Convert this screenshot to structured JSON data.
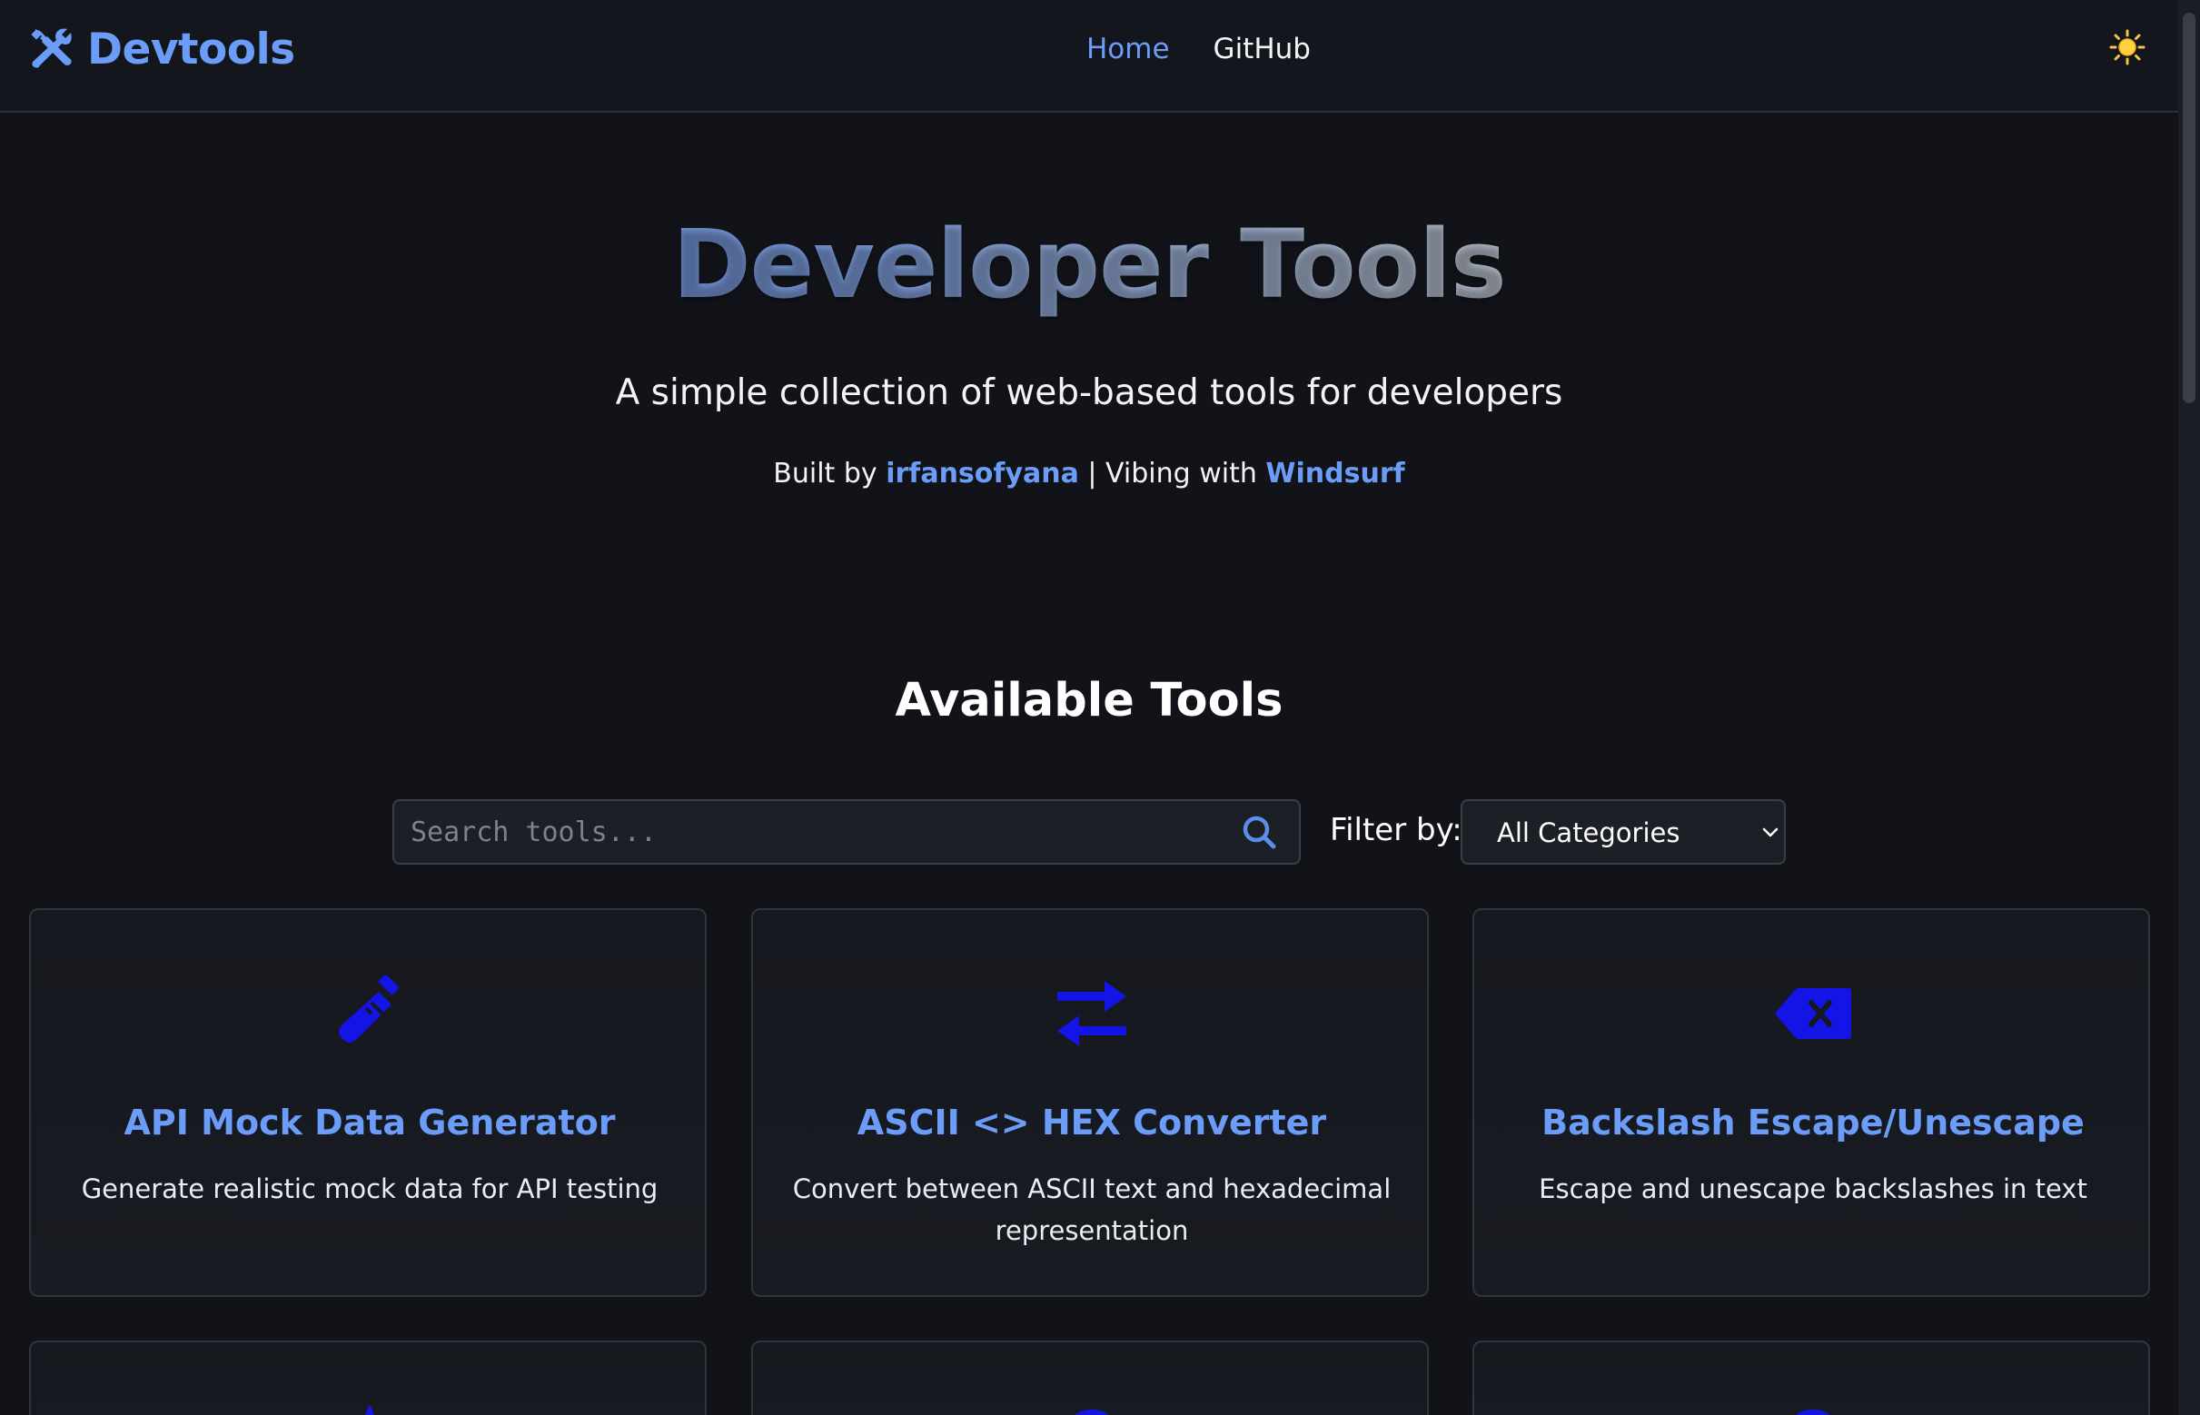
{
  "header": {
    "brand": "Devtools",
    "nav": [
      {
        "label": "Home",
        "active": true
      },
      {
        "label": "GitHub",
        "active": false
      }
    ],
    "theme_toggle_icon": "sun-icon"
  },
  "hero": {
    "title": "Developer Tools",
    "subtitle": "A simple collection of web-based tools for developers",
    "credits_prefix": "Built by",
    "author": "irfansofyana",
    "credits_separator": "| Vibing with",
    "tool_name": "Windsurf"
  },
  "tools_section": {
    "title": "Available Tools",
    "search": {
      "placeholder": "Search tools...",
      "value": ""
    },
    "filter_label": "Filter by:",
    "filter_selected": "All Categories"
  },
  "tools": [
    {
      "title": "API Mock Data Generator",
      "description": "Generate realistic mock data for API testing",
      "icon": "flask-icon"
    },
    {
      "title": "ASCII <> HEX Converter",
      "description": "Convert between ASCII text and hexadecimal representation",
      "icon": "exchange-arrows-icon"
    },
    {
      "title": "Backslash Escape/Unescape",
      "description": "Escape and unescape backslashes in text",
      "icon": "backspace-icon"
    }
  ],
  "colors": {
    "background": "#111318",
    "accent": "#6b9cf7",
    "icon_blue": "#1414e6",
    "card_border": "#30343c"
  }
}
